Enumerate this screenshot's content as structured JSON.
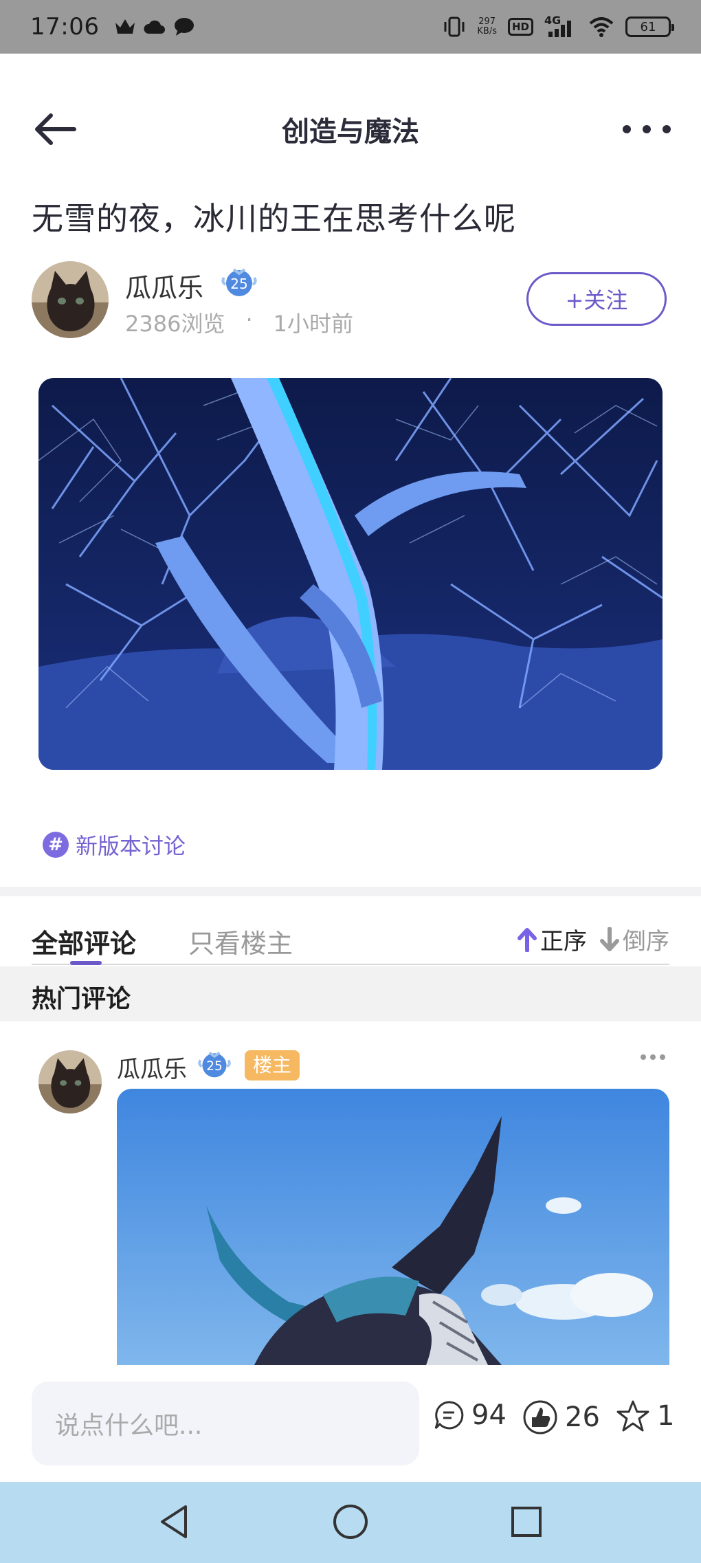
{
  "status_bar": {
    "time": "17:06",
    "net_speed_value": "297",
    "net_speed_unit": "KB/s",
    "hd_label": "HD",
    "network_label": "4G",
    "battery": "61"
  },
  "header": {
    "title": "创造与魔法"
  },
  "post": {
    "title": "无雪的夜，冰川的王在思考什么呢",
    "author_name": "瓜瓜乐",
    "author_level": "25",
    "views": "2386浏览",
    "separator": "·",
    "time_ago": "1小时前",
    "follow_label": "+关注",
    "topic_tag": "新版本讨论"
  },
  "comments_section": {
    "tab_all": "全部评论",
    "tab_owner_only": "只看楼主",
    "sort_asc": "正序",
    "sort_desc": "倒序",
    "hot_title": "热门评论"
  },
  "comment": {
    "author_name": "瓜瓜乐",
    "author_level": "25",
    "owner_badge": "楼主"
  },
  "bottom_bar": {
    "input_placeholder": "说点什么吧...",
    "comment_count": "94",
    "like_count": "26",
    "favorite_count": "1"
  }
}
